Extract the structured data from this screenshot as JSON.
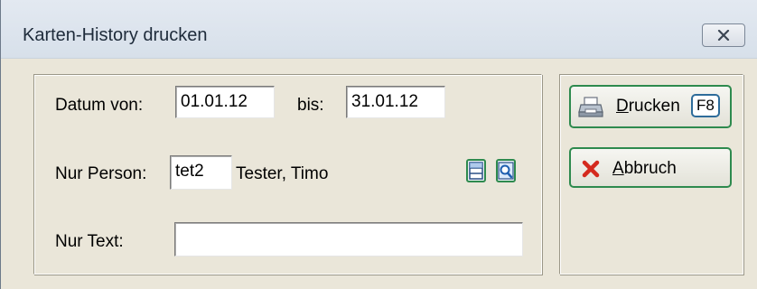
{
  "window": {
    "title": "Karten-History drucken",
    "close_icon": "close-icon"
  },
  "form": {
    "datum_label": "Datum  von:",
    "datum_von_value": "01.01.12",
    "bis_label": "bis:",
    "datum_bis_value": "31.01.12",
    "person_label": "Nur Person:",
    "person_code_value": "tet2",
    "person_name": "Tester, Timo",
    "text_label": "Nur Text:",
    "text_value": "",
    "person_list_icon": "list-icon",
    "person_search_icon": "search-icon"
  },
  "actions": {
    "print_label": "Drucken",
    "print_mnemonic": "D",
    "print_rest": "rucken",
    "print_shortcut": "F8",
    "print_icon": "printer-icon",
    "cancel_label": "Abbruch",
    "cancel_mnemonic": "A",
    "cancel_rest": "bbruch",
    "cancel_icon": "red-x-icon"
  },
  "colors": {
    "button_border": "#2e8a4e",
    "cancel_x": "#d42a1e",
    "background": "#eae6d9"
  }
}
